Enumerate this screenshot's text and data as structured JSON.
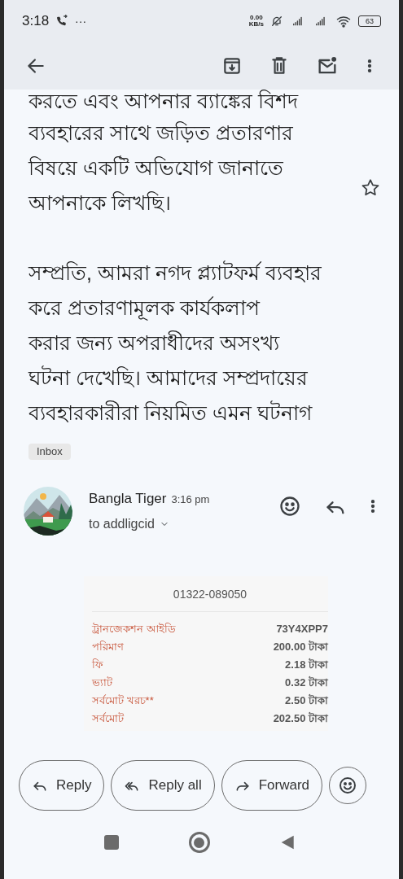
{
  "status_bar": {
    "time": "3:18",
    "more": "···",
    "net_speed": "0.00",
    "net_unit": "KB/s",
    "battery": "63"
  },
  "body_lines_top": [
    "করতে এবং আপনার ব্যাঙ্কের বিশদ",
    "ব্যবহারের সাথে জড়িত প্রতারণার",
    "বিষয়ে একটি অভিযোগ জানাতে",
    "আপনাকে লিখছি।"
  ],
  "starred": false,
  "body_lines_bottom": [
    "সম্প্রতি, আমরা নগদ প্ল্যাটফর্ম ব্যবহার",
    "করে প্রতারণামূলক কার্যকলাপ",
    "করার জন্য অপরাধীদের অসংখ্য",
    "ঘটনা দেখেছি। আমাদের সম্প্রদায়ের",
    "ব্যবহারকারীরা নিয়মিত এমন ঘটনাগ"
  ],
  "label": "Inbox",
  "message": {
    "sender": "Bangla Tiger",
    "time": "3:16 pm",
    "recipient": "to addligcid"
  },
  "receipt": {
    "phone": "01322-089050",
    "rows": [
      {
        "label": "ট্রানজেকশন আইডি",
        "value": "73Y4XPP7"
      },
      {
        "label": "পরিমাণ",
        "value": "200.00 টাকা"
      },
      {
        "label": "ফি",
        "value": "2.18 টাকা"
      },
      {
        "label": "ভ্যাট",
        "value": "0.32 টাকা"
      },
      {
        "label": "সর্বমোট খরচ**",
        "value": "2.50 টাকা"
      },
      {
        "label": "সর্বমোট",
        "value": "202.50 টাকা"
      }
    ]
  },
  "actions": [
    {
      "kind": "reply",
      "label": "Reply"
    },
    {
      "kind": "reply_all",
      "label": "Reply all"
    },
    {
      "kind": "forward",
      "label": "Forward"
    }
  ]
}
